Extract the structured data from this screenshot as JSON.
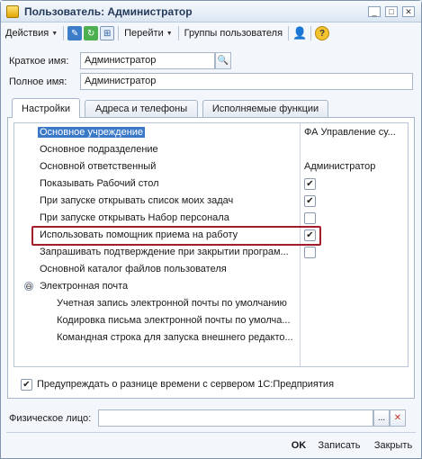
{
  "window": {
    "title": "Пользователь: Администратор",
    "controls": {
      "minimize": "_",
      "maximize": "□",
      "close": "✕"
    }
  },
  "toolbar": {
    "actions": "Действия",
    "go": "Перейти",
    "user_groups": "Группы пользователя",
    "help": "?"
  },
  "form": {
    "short_name_label": "Краткое имя:",
    "short_name_value": "Администратор",
    "full_name_label": "Полное имя:",
    "full_name_value": "Администратор"
  },
  "tabs": [
    {
      "label": "Настройки",
      "active": true
    },
    {
      "label": "Адреса и телефоны",
      "active": false
    },
    {
      "label": "Исполняемые функции",
      "active": false
    }
  ],
  "settings": {
    "rows": [
      {
        "name": "Основное учреждение",
        "value": "ФА Управление су...",
        "type": "text",
        "selected": true
      },
      {
        "name": "Основное подразделение",
        "value": "",
        "type": "text"
      },
      {
        "name": "Основной ответственный",
        "value": "Администратор",
        "type": "text"
      },
      {
        "name": "Показывать Рабочий стол",
        "value": "✔",
        "type": "check"
      },
      {
        "name": "При запуске открывать список моих задач",
        "value": "✔",
        "type": "check"
      },
      {
        "name": "При запуске открывать Набор персонала",
        "value": "",
        "type": "check"
      },
      {
        "name": "Использовать помощник приема на работу",
        "value": "✔",
        "type": "check",
        "highlighted": true
      },
      {
        "name": "Запрашивать подтверждение при закрытии програм...",
        "value": "",
        "type": "check"
      },
      {
        "name": "Основной каталог файлов пользователя",
        "value": "",
        "type": "text"
      },
      {
        "name": "Электронная почта",
        "value": "",
        "type": "group"
      },
      {
        "name": "Учетная запись электронной почты по умолчанию",
        "value": "",
        "type": "child"
      },
      {
        "name": "Кодировка письма электронной почты по умолча...",
        "value": "",
        "type": "child"
      },
      {
        "name": "Командная строка для запуска внешнего редакто...",
        "value": "",
        "type": "child"
      }
    ],
    "group_toggle": "⊖"
  },
  "time_warning": {
    "checked": "✔",
    "label": "Предупреждать о разнице времени с сервером 1С:Предприятия"
  },
  "individual": {
    "label": "Физическое лицо:",
    "value": "",
    "select_btn": "...",
    "clear_btn": "✕"
  },
  "buttons": {
    "ok": "OK",
    "write": "Записать",
    "close": "Закрыть"
  }
}
